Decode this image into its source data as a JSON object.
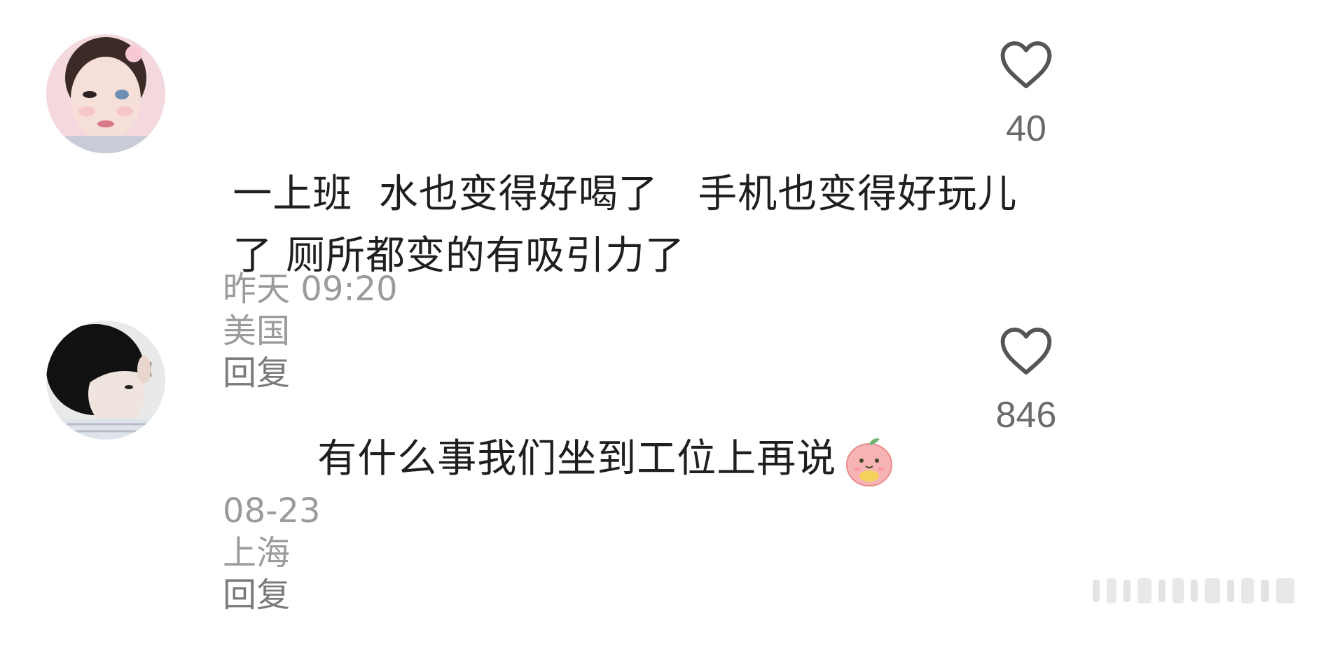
{
  "comments": [
    {
      "text_line1": "一上班  水也变得好喝了   手机也变得好玩儿",
      "text_line2": "了 厕所都变的有吸引力了",
      "date": "昨天 09:20",
      "location": "美国",
      "reply_label": "回复",
      "likes": "40"
    },
    {
      "text_line1": "有什么事我们坐到工位上再说",
      "date": "08-23",
      "location": "上海",
      "reply_label": "回复",
      "likes": "846",
      "emoji": "peach-cat-emoji"
    }
  ],
  "icons": {
    "like": "heart-outline-icon"
  },
  "colors": {
    "text": "#1f1f1f",
    "meta": "#9b9b9b",
    "like": "#6a6a6a"
  }
}
